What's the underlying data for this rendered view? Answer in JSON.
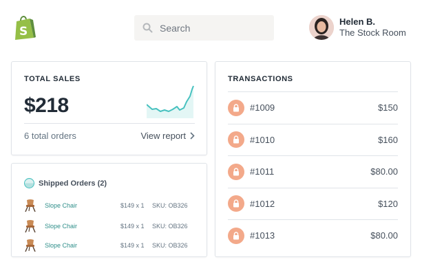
{
  "header": {
    "logo_icon": "shopify-bag-icon",
    "search": {
      "placeholder": "Search",
      "icon": "search-icon"
    },
    "user": {
      "name": "Helen B.",
      "store": "The Stock Room"
    }
  },
  "total_sales": {
    "title": "TOTAL SALES",
    "amount": "$218",
    "orders_text": "6 total orders",
    "report_link": "View report",
    "accent": "#47c1bf"
  },
  "shipped_orders": {
    "title": "Shipped Orders (2)",
    "items": [
      {
        "name": "Slope Chair",
        "price": "$149 x 1",
        "sku": "SKU: OB326"
      },
      {
        "name": "Slope Chair",
        "price": "$149 x 1",
        "sku": "SKU: OB326"
      },
      {
        "name": "Slope Chair",
        "price": "$149 x 1",
        "sku": "SKU: OB326"
      }
    ]
  },
  "transactions": {
    "title": "TRANSACTIONS",
    "lock_color": "#f3a98a",
    "rows": [
      {
        "id": "#1009",
        "amount": "$150"
      },
      {
        "id": "#1010",
        "amount": "$160"
      },
      {
        "id": "#1011",
        "amount": "$80.00"
      },
      {
        "id": "#1012",
        "amount": "$120"
      },
      {
        "id": "#1013",
        "amount": "$80.00"
      }
    ]
  }
}
